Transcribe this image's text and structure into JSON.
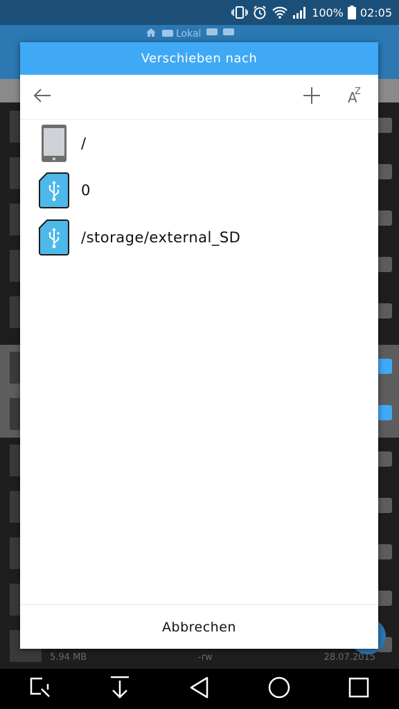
{
  "status_bar": {
    "battery": "100%",
    "time": "02:05",
    "icons": [
      "vibrate-icon",
      "alarm-icon",
      "wifi-icon",
      "signal-icon",
      "battery-icon"
    ]
  },
  "background_app": {
    "tab_label": "Lokal",
    "footer": {
      "size": "5.94 MB",
      "perms": "-rw",
      "date": "28.07.2015"
    }
  },
  "dialog": {
    "title": "Verschieben nach",
    "toolbar": {
      "back_icon": "arrow-left-icon",
      "add_icon": "plus-icon",
      "sort_icon": "sort-az-icon",
      "sort_a": "A",
      "sort_z": "Z"
    },
    "items": [
      {
        "label": "/",
        "icon": "phone-icon"
      },
      {
        "label": "0",
        "icon": "usb-sd-icon"
      },
      {
        "label": "/storage/external_SD",
        "icon": "usb-sd-icon"
      }
    ],
    "cancel_label": "Abbrechen"
  },
  "colors": {
    "header": "#3fa9f5",
    "app_bar": "#2b78b3",
    "status_bar": "#1b4f78",
    "sd_icon_fill": "#4db8ea"
  },
  "navbar": {
    "icons": [
      "screenshot-icon",
      "download-icon",
      "back-triangle-icon",
      "home-circle-icon",
      "recents-square-icon"
    ]
  }
}
